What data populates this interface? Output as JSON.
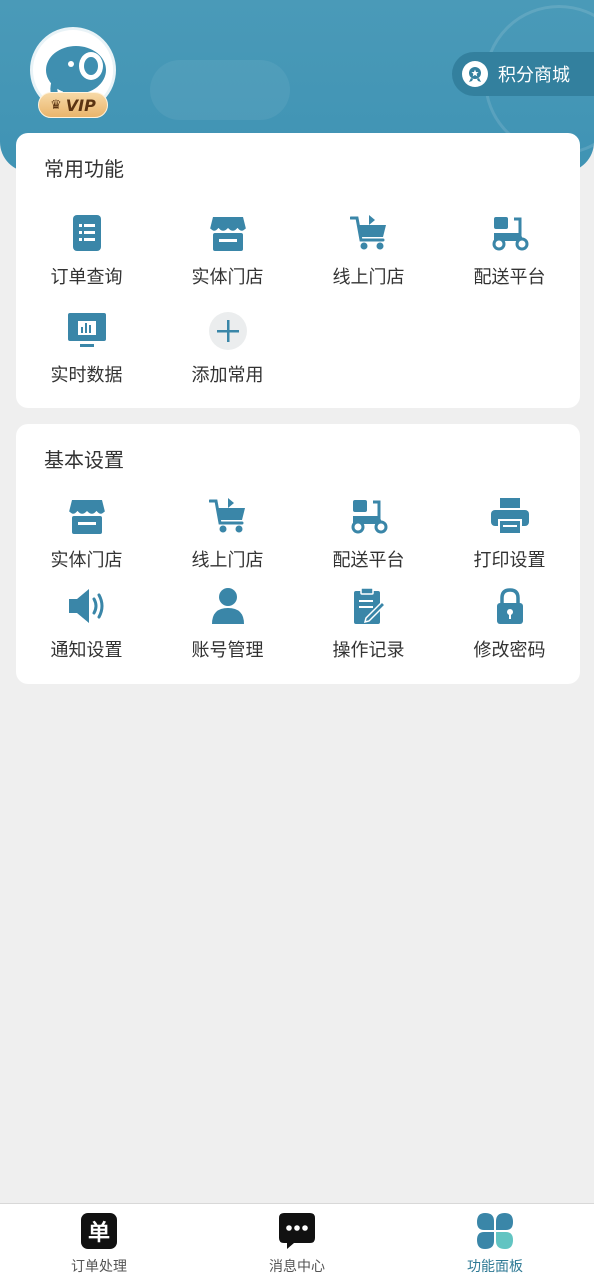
{
  "header": {
    "vip_label": "VIP",
    "points_mall_label": "积分商城"
  },
  "common": {
    "title": "常用功能",
    "items": [
      {
        "label": "订单查询",
        "icon": "order-list-icon"
      },
      {
        "label": "实体门店",
        "icon": "store-icon"
      },
      {
        "label": "线上门店",
        "icon": "cart-icon"
      },
      {
        "label": "配送平台",
        "icon": "scooter-icon"
      },
      {
        "label": "实时数据",
        "icon": "chart-icon"
      },
      {
        "label": "添加常用",
        "icon": "plus-icon"
      }
    ]
  },
  "basic": {
    "title": "基本设置",
    "items": [
      {
        "label": "实体门店",
        "icon": "store-icon"
      },
      {
        "label": "线上门店",
        "icon": "cart-icon"
      },
      {
        "label": "配送平台",
        "icon": "scooter-icon"
      },
      {
        "label": "打印设置",
        "icon": "printer-icon"
      },
      {
        "label": "通知设置",
        "icon": "speaker-icon"
      },
      {
        "label": "账号管理",
        "icon": "user-icon"
      },
      {
        "label": "操作记录",
        "icon": "edit-log-icon"
      },
      {
        "label": "修改密码",
        "icon": "lock-icon"
      }
    ]
  },
  "tabbar": {
    "tabs": [
      {
        "label": "订单处理",
        "glyph": "单"
      },
      {
        "label": "消息中心",
        "glyph": "•••"
      },
      {
        "label": "功能面板"
      }
    ]
  },
  "colors": {
    "primary": "#3f93b4",
    "icon": "#3a86a8",
    "active_tab": "#2f7a95"
  }
}
